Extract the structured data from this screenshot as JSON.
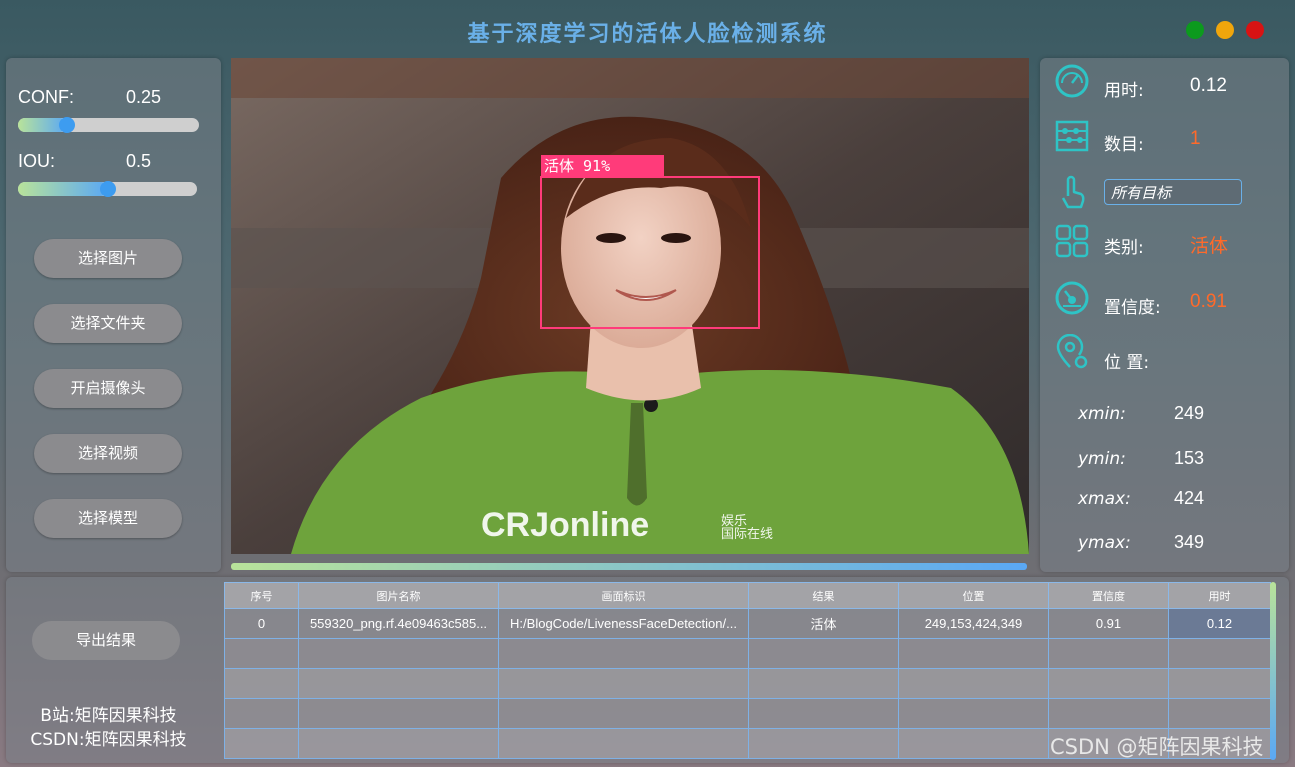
{
  "app": {
    "title": "基于深度学习的活体人脸检测系统"
  },
  "window_controls": [
    "maximize",
    "minimize",
    "close"
  ],
  "sliders": {
    "conf": {
      "label": "CONF:",
      "value": "0.25",
      "fraction": 0.25
    },
    "iou": {
      "label": "IOU:",
      "value": "0.5",
      "fraction": 0.5
    }
  },
  "buttons": {
    "select_image": "选择图片",
    "select_folder": "选择文件夹",
    "open_camera": "开启摄像头",
    "select_video": "选择视频",
    "select_model": "选择模型",
    "export": "导出结果"
  },
  "detection_overlay": {
    "label": "活体  91%",
    "box_color": "#ff3b7a"
  },
  "watermark_logo": {
    "text_main": "CRJonline",
    "text_cn1": "娱乐",
    "text_cn2": "国际在线"
  },
  "info": {
    "time_label": "用时:",
    "time_value": "0.12",
    "count_label": "数目:",
    "count_value": "1",
    "target_select": "所有目标",
    "class_label": "类别:",
    "class_value": "活体",
    "conf_label": "置信度:",
    "conf_value": "0.91",
    "pos_label": "位 置:",
    "xmin_label": "xmin:",
    "xmin_value": "249",
    "ymin_label": "ymin:",
    "ymin_value": "153",
    "xmax_label": "xmax:",
    "xmax_value": "424",
    "ymax_label": "ymax:",
    "ymax_value": "349",
    "accent_color": "#ff6a2a",
    "icon_color": "#2ec4c6"
  },
  "table": {
    "headers": [
      "序号",
      "图片名称",
      "画面标识",
      "结果",
      "位置",
      "置信度",
      "用时"
    ],
    "rows": [
      [
        "0",
        "559320_png.rf.4e09463c585...",
        "H:/BlogCode/LivenessFaceDetection/...",
        "活体",
        "249,153,424,349",
        "0.91",
        "0.12"
      ]
    ],
    "empty_rows": 4
  },
  "footer": {
    "bilibili": "B站:矩阵因果科技",
    "csdn": "CSDN:矩阵因果科技"
  },
  "watermark": "CSDN @矩阵因果科技"
}
